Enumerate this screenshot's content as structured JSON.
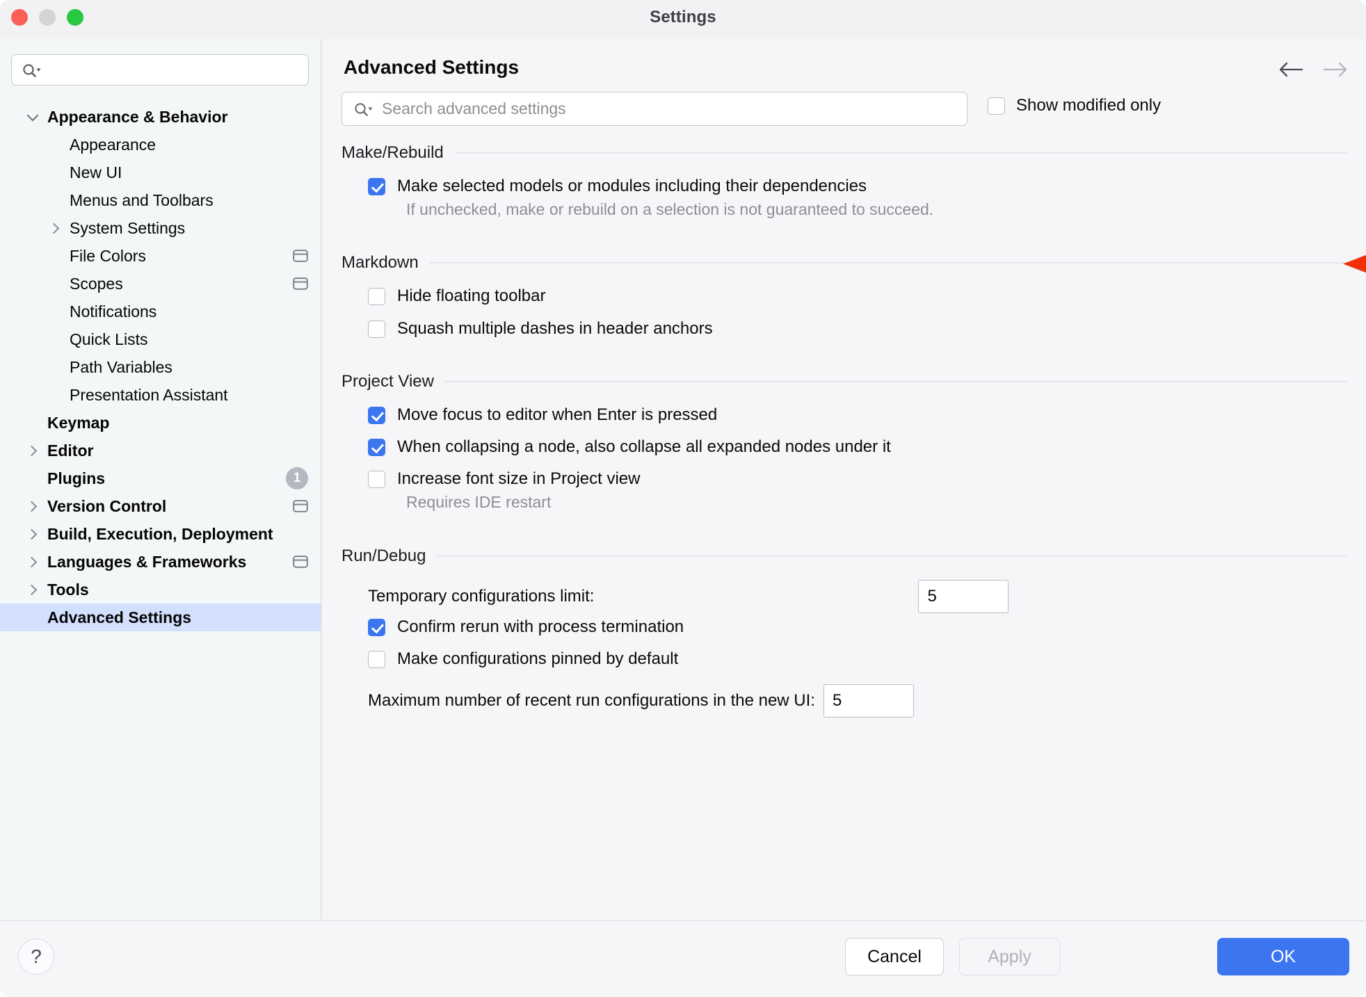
{
  "window": {
    "title": "Settings",
    "traffic_lights": [
      "close",
      "minimize",
      "zoom"
    ]
  },
  "sidebar": {
    "search": {
      "value": "",
      "placeholder": ""
    },
    "items": [
      {
        "label": "Appearance & Behavior",
        "level": 0,
        "twisty": "down",
        "selected": false,
        "adorn": "none"
      },
      {
        "label": "Appearance",
        "level": 1,
        "twisty": "none",
        "selected": false,
        "adorn": "none"
      },
      {
        "label": "New UI",
        "level": 1,
        "twisty": "none",
        "selected": false,
        "adorn": "none"
      },
      {
        "label": "Menus and Toolbars",
        "level": 1,
        "twisty": "none",
        "selected": false,
        "adorn": "none"
      },
      {
        "label": "System Settings",
        "level": 1,
        "twisty": "right",
        "selected": false,
        "adorn": "none"
      },
      {
        "label": "File Colors",
        "level": 1,
        "twisty": "none",
        "selected": false,
        "adorn": "project-scope-icon"
      },
      {
        "label": "Scopes",
        "level": 1,
        "twisty": "none",
        "selected": false,
        "adorn": "project-scope-icon"
      },
      {
        "label": "Notifications",
        "level": 1,
        "twisty": "none",
        "selected": false,
        "adorn": "none"
      },
      {
        "label": "Quick Lists",
        "level": 1,
        "twisty": "none",
        "selected": false,
        "adorn": "none"
      },
      {
        "label": "Path Variables",
        "level": 1,
        "twisty": "none",
        "selected": false,
        "adorn": "none"
      },
      {
        "label": "Presentation Assistant",
        "level": 1,
        "twisty": "none",
        "selected": false,
        "adorn": "none"
      },
      {
        "label": "Keymap",
        "level": 0,
        "twisty": "none",
        "selected": false,
        "adorn": "none"
      },
      {
        "label": "Editor",
        "level": 0,
        "twisty": "right",
        "selected": false,
        "adorn": "none"
      },
      {
        "label": "Plugins",
        "level": 0,
        "twisty": "none",
        "selected": false,
        "adorn": "badge",
        "badge": "1"
      },
      {
        "label": "Version Control",
        "level": 0,
        "twisty": "right",
        "selected": false,
        "adorn": "project-scope-icon"
      },
      {
        "label": "Build, Execution, Deployment",
        "level": 0,
        "twisty": "right",
        "selected": false,
        "adorn": "none"
      },
      {
        "label": "Languages & Frameworks",
        "level": 0,
        "twisty": "right",
        "selected": false,
        "adorn": "project-scope-icon"
      },
      {
        "label": "Tools",
        "level": 0,
        "twisty": "right",
        "selected": false,
        "adorn": "none"
      },
      {
        "label": "Advanced Settings",
        "level": 0,
        "twisty": "none",
        "selected": true,
        "adorn": "none"
      }
    ]
  },
  "main": {
    "page_title": "Advanced Settings",
    "nav": {
      "back": "back-arrow",
      "forward": "forward-arrow",
      "back_enabled": true,
      "forward_enabled": false
    },
    "search": {
      "value": "",
      "placeholder": "Search advanced settings"
    },
    "show_modified_only": {
      "label": "Show modified only",
      "checked": false
    },
    "sections": [
      {
        "title": "Make/Rebuild",
        "rows": [
          {
            "type": "checkbox",
            "label": "Make selected models or modules including their dependencies",
            "checked": true,
            "note": "If unchecked, make or rebuild on a selection is not guaranteed to succeed."
          }
        ]
      },
      {
        "title": "Markdown",
        "rows": [
          {
            "type": "checkbox",
            "label": "Hide floating toolbar",
            "checked": false
          },
          {
            "type": "checkbox",
            "label": "Squash multiple dashes in header anchors",
            "checked": false
          }
        ]
      },
      {
        "title": "Project View",
        "rows": [
          {
            "type": "checkbox",
            "label": "Move focus to editor when Enter is pressed",
            "checked": true
          },
          {
            "type": "checkbox",
            "label": "When collapsing a node, also collapse all expanded nodes under it",
            "checked": true
          },
          {
            "type": "checkbox",
            "label": "Increase font size in Project view",
            "checked": false,
            "note": "Requires IDE restart"
          }
        ]
      },
      {
        "title": "Run/Debug",
        "rows": [
          {
            "type": "field",
            "label": "Temporary configurations limit:",
            "value": "5"
          },
          {
            "type": "checkbox",
            "label": "Confirm rerun with process termination",
            "checked": true
          },
          {
            "type": "checkbox",
            "label": "Make configurations pinned by default",
            "checked": false
          },
          {
            "type": "field",
            "label": "Maximum number of recent run configurations in the new UI:",
            "value": "5"
          }
        ]
      }
    ]
  },
  "annotation": {
    "shape": "left-pointing-arrow",
    "color": "#f23005"
  },
  "footer": {
    "help_label": "?",
    "cancel_label": "Cancel",
    "apply_label": "Apply",
    "apply_enabled": false,
    "ok_label": "OK"
  },
  "colors": {
    "accent_blue": "#3b76f0",
    "selection_blue": "#d3e0fd",
    "panel_bg": "#f6f6f9",
    "sidebar_bg": "#f4f7f7",
    "annotation_red": "#f23005",
    "muted_text": "#8e8e93"
  }
}
